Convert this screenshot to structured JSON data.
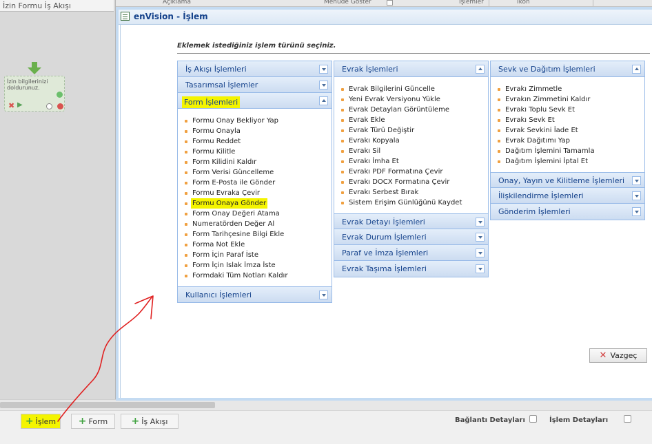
{
  "background": {
    "panel_title": "İzin Formu İş Akışı",
    "column_headers": [
      "Açıklama",
      "Menüde Göster",
      "İşlemler",
      "İkon"
    ],
    "node_text": "İzin bilgilerinizi doldurunuz."
  },
  "bottom_bar": {
    "buttons": [
      "İşlem",
      "Form",
      "İş Akışı"
    ],
    "baglanti_detaylari": "Bağlantı Detayları",
    "islem_detaylari": "İşlem Detayları"
  },
  "dialog": {
    "title": "enVision - İşlem",
    "instruction": "Eklemek istediğiniz işlem türünü seçiniz.",
    "cancel_label": "Vazgeç",
    "columns": [
      {
        "panels": [
          {
            "title": "İş Akışı İşlemleri",
            "expanded": false,
            "items": []
          },
          {
            "title": "Tasarımsal İşlemler",
            "expanded": false,
            "items": []
          },
          {
            "title": "Form İşlemleri",
            "expanded": true,
            "items": [
              "Formu Onay Bekliyor Yap",
              "Formu Onayla",
              "Formu Reddet",
              "Formu Kilitle",
              "Form Kilidini Kaldır",
              "Form Verisi Güncelleme",
              "Form E-Posta ile Gönder",
              "Formu Evraka Çevir",
              "Formu Onaya Gönder",
              "Form Onay Değeri Atama",
              "Numeratörden Değer Al",
              "Form Tarihçesine Bilgi Ekle",
              "Forma Not Ekle",
              "Form İçin Paraf İste",
              "Form İçin Islak İmza İste",
              "Formdaki Tüm Notları Kaldır"
            ]
          },
          {
            "title": "Kullanıcı İşlemleri",
            "expanded": false,
            "items": []
          }
        ]
      },
      {
        "panels": [
          {
            "title": "Evrak İşlemleri",
            "expanded": true,
            "items": [
              "Evrak Bilgilerini Güncelle",
              "Yeni Evrak Versiyonu Yükle",
              "Evrak Detayları Görüntüleme",
              "Evrak Ekle",
              "Evrak Türü Değiştir",
              "Evrakı Kopyala",
              "Evrakı Sil",
              "Evrakı İmha Et",
              "Evrakı PDF Formatına Çevir",
              "Evrakı DOCX Formatına Çevir",
              "Evrakı Serbest Bırak",
              "Sistem Erişim Günlüğünü Kaydet"
            ]
          },
          {
            "title": "Evrak Detayı İşlemleri",
            "expanded": false,
            "items": []
          },
          {
            "title": "Evrak Durum İşlemleri",
            "expanded": false,
            "items": []
          },
          {
            "title": "Paraf ve İmza İşlemleri",
            "expanded": false,
            "items": []
          },
          {
            "title": "Evrak Taşıma İşlemleri",
            "expanded": false,
            "items": []
          }
        ]
      },
      {
        "panels": [
          {
            "title": "Sevk ve Dağıtım İşlemleri",
            "expanded": true,
            "items": [
              "Evrakı Zimmetle",
              "Evrakın Zimmetini Kaldır",
              "Evrakı Toplu Sevk Et",
              "Evrakı Sevk Et",
              "Evrak Sevkini İade Et",
              "Evrak Dağıtımı Yap",
              "Dağıtım İşlemini Tamamla",
              "Dağıtım İşlemini İptal Et"
            ]
          },
          {
            "title": "Onay, Yayın ve Kilitleme İşlemleri",
            "expanded": false,
            "items": []
          },
          {
            "title": "İlişkilendirme İşlemleri",
            "expanded": false,
            "items": []
          },
          {
            "title": "Gönderim İşlemleri",
            "expanded": false,
            "items": []
          }
        ]
      }
    ]
  },
  "highlights": {
    "panel": "Form İşlemleri",
    "item": "Formu Onaya Gönder",
    "button": "İşlem"
  },
  "colors": {
    "highlight": "#f4f400",
    "panel_header_text": "#15428b",
    "panel_border": "#99bbe8",
    "bullet": "#f0a040",
    "annotation_arrow": "#e02020"
  }
}
